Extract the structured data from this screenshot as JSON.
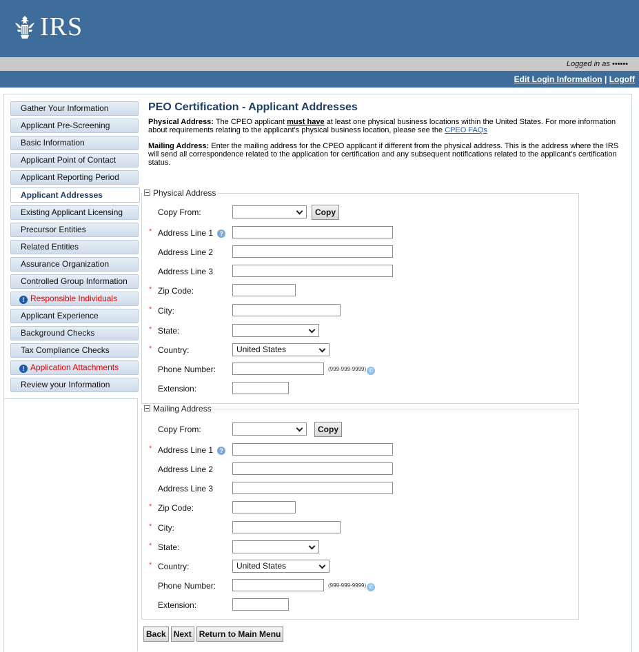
{
  "header": {
    "logo_text": "IRS",
    "logged_in_text": "Logged in as ••••••",
    "edit_login_label": "Edit Login Information",
    "separator": "|",
    "logoff_label": "Logoff"
  },
  "sidebar": {
    "items": [
      {
        "label": "Gather Your Information",
        "active": false,
        "alert": false
      },
      {
        "label": "Applicant Pre-Screening",
        "active": false,
        "alert": false
      },
      {
        "label": "Basic Information",
        "active": false,
        "alert": false
      },
      {
        "label": "Applicant Point of Contact",
        "active": false,
        "alert": false
      },
      {
        "label": "Applicant Reporting Period",
        "active": false,
        "alert": false
      },
      {
        "label": "Applicant Addresses",
        "active": true,
        "alert": false
      },
      {
        "label": "Existing Applicant Licensing",
        "active": false,
        "alert": false
      },
      {
        "label": "Precursor Entities",
        "active": false,
        "alert": false
      },
      {
        "label": "Related Entities",
        "active": false,
        "alert": false
      },
      {
        "label": "Assurance Organization",
        "active": false,
        "alert": false
      },
      {
        "label": "Controlled Group Information",
        "active": false,
        "alert": false
      },
      {
        "label": "Responsible Individuals",
        "active": false,
        "alert": true
      },
      {
        "label": "Applicant Experience",
        "active": false,
        "alert": false
      },
      {
        "label": "Background Checks",
        "active": false,
        "alert": false
      },
      {
        "label": "Tax Compliance Checks",
        "active": false,
        "alert": false
      },
      {
        "label": "Application Attachments",
        "active": false,
        "alert": true
      },
      {
        "label": "Review your Information",
        "active": false,
        "alert": false
      }
    ],
    "alert_icon": "exclamation-icon",
    "alert_color": "#e10000"
  },
  "main": {
    "title": "PEO Certification - Applicant Addresses",
    "physical_intro": {
      "heading": "Physical Address:",
      "text_before": " The CPEO applicant ",
      "emphasis": "must have",
      "text_after": " at least one physical business locations within the United States. For more information about requirements relating to the applicant's physical business location, please see the ",
      "link": "CPEO FAQs"
    },
    "mailing_intro": {
      "heading": "Mailing Address:",
      "text": " Enter the mailing address for the CPEO applicant if different from the physical address. This is the address where the IRS will send all correspondence related to the application for certification and any subsequent notifications related to the applicant's certification status."
    }
  },
  "physical": {
    "legend": "Physical Address",
    "copy_from_label": "Copy From:",
    "copy_from_value": "",
    "copy_button": "Copy",
    "address1_label": "Address Line 1",
    "address2_label": "Address Line 2",
    "address3_label": "Address Line 3",
    "zip_label": "Zip Code:",
    "city_label": "City:",
    "state_label": "State:",
    "state_value": "",
    "country_label": "Country:",
    "country_value": "United States",
    "phone_label": "Phone Number:",
    "phone_hint": "(999-999-9999)",
    "extension_label": "Extension:",
    "required_mark": "*"
  },
  "mailing": {
    "legend": "Mailing Address",
    "copy_from_label": "Copy From:",
    "copy_from_value": "",
    "copy_button": "Copy",
    "address1_label": "Address Line 1",
    "address2_label": "Address Line 2",
    "address3_label": "Address Line 3",
    "zip_label": "Zip Code:",
    "city_label": "City:",
    "state_label": "State:",
    "state_value": "",
    "country_label": "Country:",
    "country_value": "United States",
    "phone_label": "Phone Number:",
    "phone_hint": "(999-999-9999)",
    "extension_label": "Extension:",
    "required_mark": "*"
  },
  "buttons": {
    "back": "Back",
    "next": "Next",
    "return": "Return to Main Menu"
  },
  "colors": {
    "header_bg": "#3e6d9c",
    "title_color": "#1e3f66",
    "link_color": "#1f56b5",
    "required_color": "#e8442e"
  }
}
